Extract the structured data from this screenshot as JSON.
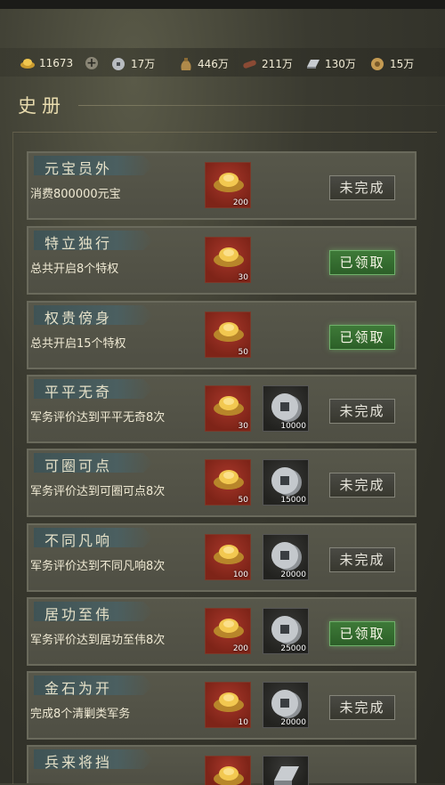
{
  "resources": [
    {
      "icon": "gold-ingot-icon",
      "value": "11673"
    },
    {
      "icon": "silver-coin-icon",
      "value": "17万"
    },
    {
      "icon": "grain-sack-icon",
      "value": "446万"
    },
    {
      "icon": "wood-log-icon",
      "value": "211万"
    },
    {
      "icon": "iron-bar-icon",
      "value": "130万"
    },
    {
      "icon": "bronze-coin-icon",
      "value": "15万"
    }
  ],
  "page_title": "史册",
  "achievements": [
    {
      "name": "元宝员外",
      "desc": "消费800000元宝",
      "rewards": [
        {
          "icon": "gold-ingot-icon",
          "qty": "200"
        }
      ],
      "status": "未完成"
    },
    {
      "name": "特立独行",
      "desc": "总共开启8个特权",
      "rewards": [
        {
          "icon": "gold-ingot-icon",
          "qty": "30"
        }
      ],
      "status": "已领取"
    },
    {
      "name": "权贵傍身",
      "desc": "总共开启15个特权",
      "rewards": [
        {
          "icon": "gold-ingot-icon",
          "qty": "50"
        }
      ],
      "status": "已领取"
    },
    {
      "name": "平平无奇",
      "desc": "军务评价达到平平无奇8次",
      "rewards": [
        {
          "icon": "gold-ingot-icon",
          "qty": "30"
        },
        {
          "icon": "silver-coin-icon",
          "qty": "10000"
        }
      ],
      "status": "未完成"
    },
    {
      "name": "可圈可点",
      "desc": "军务评价达到可圈可点8次",
      "rewards": [
        {
          "icon": "gold-ingot-icon",
          "qty": "50"
        },
        {
          "icon": "silver-coin-icon",
          "qty": "15000"
        }
      ],
      "status": "未完成"
    },
    {
      "name": "不同凡响",
      "desc": "军务评价达到不同凡响8次",
      "rewards": [
        {
          "icon": "gold-ingot-icon",
          "qty": "100"
        },
        {
          "icon": "silver-coin-icon",
          "qty": "20000"
        }
      ],
      "status": "未完成"
    },
    {
      "name": "居功至伟",
      "desc": "军务评价达到居功至伟8次",
      "rewards": [
        {
          "icon": "gold-ingot-icon",
          "qty": "200"
        },
        {
          "icon": "silver-coin-icon",
          "qty": "25000"
        }
      ],
      "status": "已领取"
    },
    {
      "name": "金石为开",
      "desc": "完成8个清剿类军务",
      "rewards": [
        {
          "icon": "gold-ingot-icon",
          "qty": "10"
        },
        {
          "icon": "silver-coin-icon",
          "qty": "20000"
        }
      ],
      "status": "未完成"
    },
    {
      "name": "兵来将挡",
      "desc": "",
      "rewards": [
        {
          "icon": "gold-ingot-icon",
          "qty": ""
        },
        {
          "icon": "iron-bar-icon",
          "qty": ""
        }
      ],
      "status": ""
    }
  ]
}
